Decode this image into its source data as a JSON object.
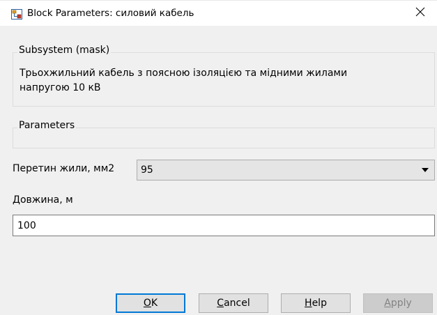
{
  "window": {
    "title": "Block Parameters: силовий кабель",
    "icon": "simulink-block-icon",
    "close_glyph": "✕"
  },
  "mask_group": {
    "legend": "Subsystem (mask)",
    "description_line1": "Трьохжильний кабель з поясною ізоляцією та мідними жилами",
    "description_line2": "напругою 10 кВ"
  },
  "parameters_group": {
    "legend": "Parameters"
  },
  "cross_section": {
    "label": "Перетин жили, мм2",
    "selected": "95"
  },
  "length": {
    "label": "Довжина, м",
    "value": "100"
  },
  "buttons": {
    "ok": {
      "mnemonic": "O",
      "rest": "K"
    },
    "cancel": {
      "mnemonic": "C",
      "rest": "ancel"
    },
    "help": {
      "mnemonic": "H",
      "rest": "elp"
    },
    "apply": {
      "mnemonic": "A",
      "rest": "pply",
      "enabled": false
    }
  }
}
